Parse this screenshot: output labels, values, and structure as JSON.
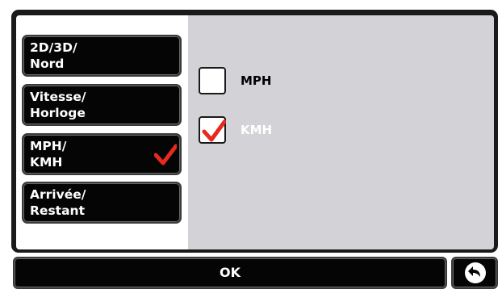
{
  "menu": {
    "items": [
      {
        "label": "2D/3D/\nNord",
        "selected": false
      },
      {
        "label": "Vitesse/\nHorloge",
        "selected": false
      },
      {
        "label": "MPH/\nKMH",
        "selected": true
      },
      {
        "label": "Arrivée/\nRestant",
        "selected": false
      }
    ],
    "selected_check_icon": "checkmark-icon"
  },
  "options": {
    "mph": {
      "label": "MPH",
      "checked": false,
      "label_color": "#000000"
    },
    "kmh": {
      "label": "KMH",
      "checked": true,
      "label_color": "#ffffff"
    }
  },
  "footer": {
    "ok_label": "OK",
    "back_icon": "back-arrow-icon"
  },
  "colors": {
    "check_red": "#e52a1f",
    "panel_gray": "#d3d2d6",
    "button_black": "#050505"
  }
}
